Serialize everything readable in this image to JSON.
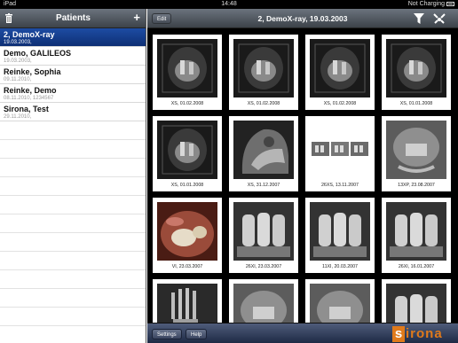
{
  "status_bar": {
    "device": "iPad",
    "time": "14:48",
    "charging": "Not Charging"
  },
  "patients_panel": {
    "title": "Patients",
    "patients": [
      {
        "name": "2, DemoX-ray",
        "date": "19.03.2003,",
        "selected": true
      },
      {
        "name": "Demo, GALILEOS",
        "date": "19.03.2003,",
        "selected": false
      },
      {
        "name": "Reinke, Sophia",
        "date": "09.11.2010,",
        "selected": false
      },
      {
        "name": "Reinke, Demo",
        "date": "08.11.2010, 1234567",
        "selected": false
      },
      {
        "name": "Sirona, Test",
        "date": "29.11.2010,",
        "selected": false
      }
    ]
  },
  "detail_panel": {
    "edit_label": "Edit",
    "title": "2, DemoX-ray, 19.03.2003",
    "images": [
      {
        "caption": "XS, 01.02.2008",
        "kind": "cbct-dark"
      },
      {
        "caption": "XS, 01.02.2008",
        "kind": "cbct-dark"
      },
      {
        "caption": "XS, 01.02.2008",
        "kind": "cbct-dark"
      },
      {
        "caption": "XS, 01.01.2008",
        "kind": "cbct-dark"
      },
      {
        "caption": "XS, 01.01.2008",
        "kind": "cbct-dark"
      },
      {
        "caption": "XS, 31.12.2007",
        "kind": "ceph"
      },
      {
        "caption": "26XS, 13.11.2007",
        "kind": "strips"
      },
      {
        "caption": "13XP, 23.08.2007",
        "kind": "pano-gray"
      },
      {
        "caption": "VI, 23.03.2007",
        "kind": "photo"
      },
      {
        "caption": "26XI, 23.03.2007",
        "kind": "intraoral"
      },
      {
        "caption": "11XI, 20.03.2007",
        "kind": "intraoral"
      },
      {
        "caption": "26XI, 16.01.2007",
        "kind": "intraoral"
      },
      {
        "caption": "",
        "kind": "hand"
      },
      {
        "caption": "",
        "kind": "pano-gray"
      },
      {
        "caption": "",
        "kind": "pano-gray"
      },
      {
        "caption": "",
        "kind": "intraoral"
      }
    ]
  },
  "toolbar": {
    "settings_label": "Settings",
    "help_label": "Help",
    "logo_text": "sirona"
  },
  "colors": {
    "selection": "#1d4ca3",
    "logo": "#e07a1b"
  },
  "icons": [
    "trash-icon",
    "plus-icon",
    "filter-icon",
    "tools-icon",
    "battery-icon"
  ]
}
